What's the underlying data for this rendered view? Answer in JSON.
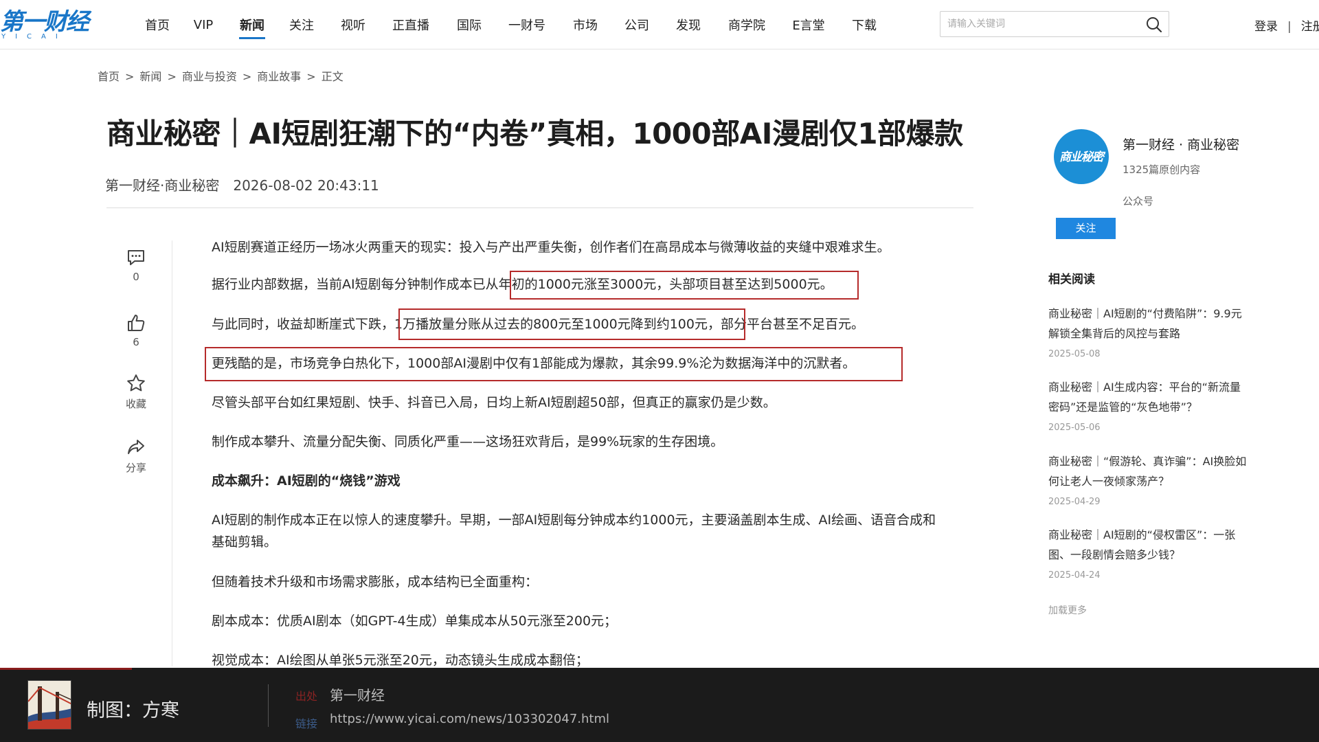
{
  "logo": {
    "text_cn": "第一财经",
    "text_en": "YICAI",
    "color": "#1976c8"
  },
  "nav": {
    "items": [
      "首页",
      "VIP",
      "新闻",
      "关注",
      "视听",
      "正直播",
      "国际",
      "一财号",
      "市场",
      "公司",
      "发现",
      "商学院",
      "E言堂",
      "下载"
    ],
    "active": "新闻"
  },
  "search": {
    "placeholder": "请输入关键词",
    "icon": "search-icon"
  },
  "user": {
    "login": "登录",
    "separator": "|",
    "register": "注册"
  },
  "breadcrumb": [
    "首页",
    "新闻",
    "商业与投资",
    "商业故事",
    "正文"
  ],
  "article": {
    "title": "商业秘密｜AI短剧狂潮下的“内卷”真相，1000部AI漫剧仅1部爆款",
    "source": "第一财经·商业秘密",
    "time": "2026-08-02 20:43:11",
    "paragraphs": [
      "AI短剧赛道正经历一场冰火两重天的现实：投入与产出严重失衡，创作者们在高昂成本与微薄收益的夹缝中艰难求生。",
      "据行业内部数据，当前AI短剧每分钟制作成本已从年初的1000元涨至3000元，头部项目甚至达到5000元。",
      "与此同时，收益却断崖式下跌，1万播放量分账从过去的800元至1000元降到约100元，部分平台甚至不足百元。",
      "更残酷的是，市场竞争白热化下，1000部AI漫剧中仅有1部能成为爆款，其余99.9%沦为数据海洋中的沉默者。",
      "尽管头部平台如红果短剧、快手、抖音已入局，日均上新AI短剧超50部，但真正的赢家仍是少数。",
      "制作成本攀升、流量分配失衡、同质化严重——这场狂欢背后，是99%玩家的生存困境。",
      "成本飙升：AI短剧的“烧钱”游戏",
      "AI短剧的制作成本正在以惊人的速度攀升。早期，一部AI短剧每分钟成本约1000元，主要涵盖剧本生成、AI绘画、语音合成和基础剪辑。",
      "但随着技术升级和市场需求膨胀，成本结构已全面重构：",
      "剧本成本：优质AI剧本（如GPT-4生成）单集成本从50元涨至200元；",
      "视觉成本：AI绘图从单张5元涨至20元，动态镜头生成成本翻倍；"
    ],
    "highlight_color": "#b52a2a"
  },
  "actions": [
    {
      "icon": "comment-icon",
      "label": "0"
    },
    {
      "icon": "thumbs-up-icon",
      "label": "6"
    },
    {
      "icon": "star-icon",
      "label": "收藏"
    },
    {
      "icon": "share-icon",
      "label": "分享"
    }
  ],
  "sidebar": {
    "account_name": "第一财经 · 商业秘密",
    "account_count": "1325篇原创内容",
    "account_type": "公众号",
    "avatar_text": "商业秘密",
    "avatar_color": "#1c8fd6",
    "follow_label": "关注",
    "related_heading": "相关阅读",
    "related": [
      {
        "title": "商业秘密｜AI短剧的“付费陷阱”：9.9元解锁全集背后的风控与套路",
        "date": "2025-05-08"
      },
      {
        "title": "商业秘密｜AI生成内容：平台的“新流量密码”还是监管的“灰色地带”？",
        "date": "2025-05-06"
      },
      {
        "title": "商业秘密｜“假游轮、真诈骗”：AI换脸如何让老人一夜倾家荡产？",
        "date": "2025-04-29"
      },
      {
        "title": "商业秘密｜AI短剧的“侵权雷区”：一张图、一段剧情会赔多少钱？",
        "date": "2025-04-24"
      }
    ],
    "load_more": "加载更多"
  },
  "caption": {
    "credit": "制图：方寒",
    "source_label": "出处",
    "source": "第一财经",
    "link_label": "链接",
    "link": "https://www.yicai.com/news/103302047.html"
  }
}
